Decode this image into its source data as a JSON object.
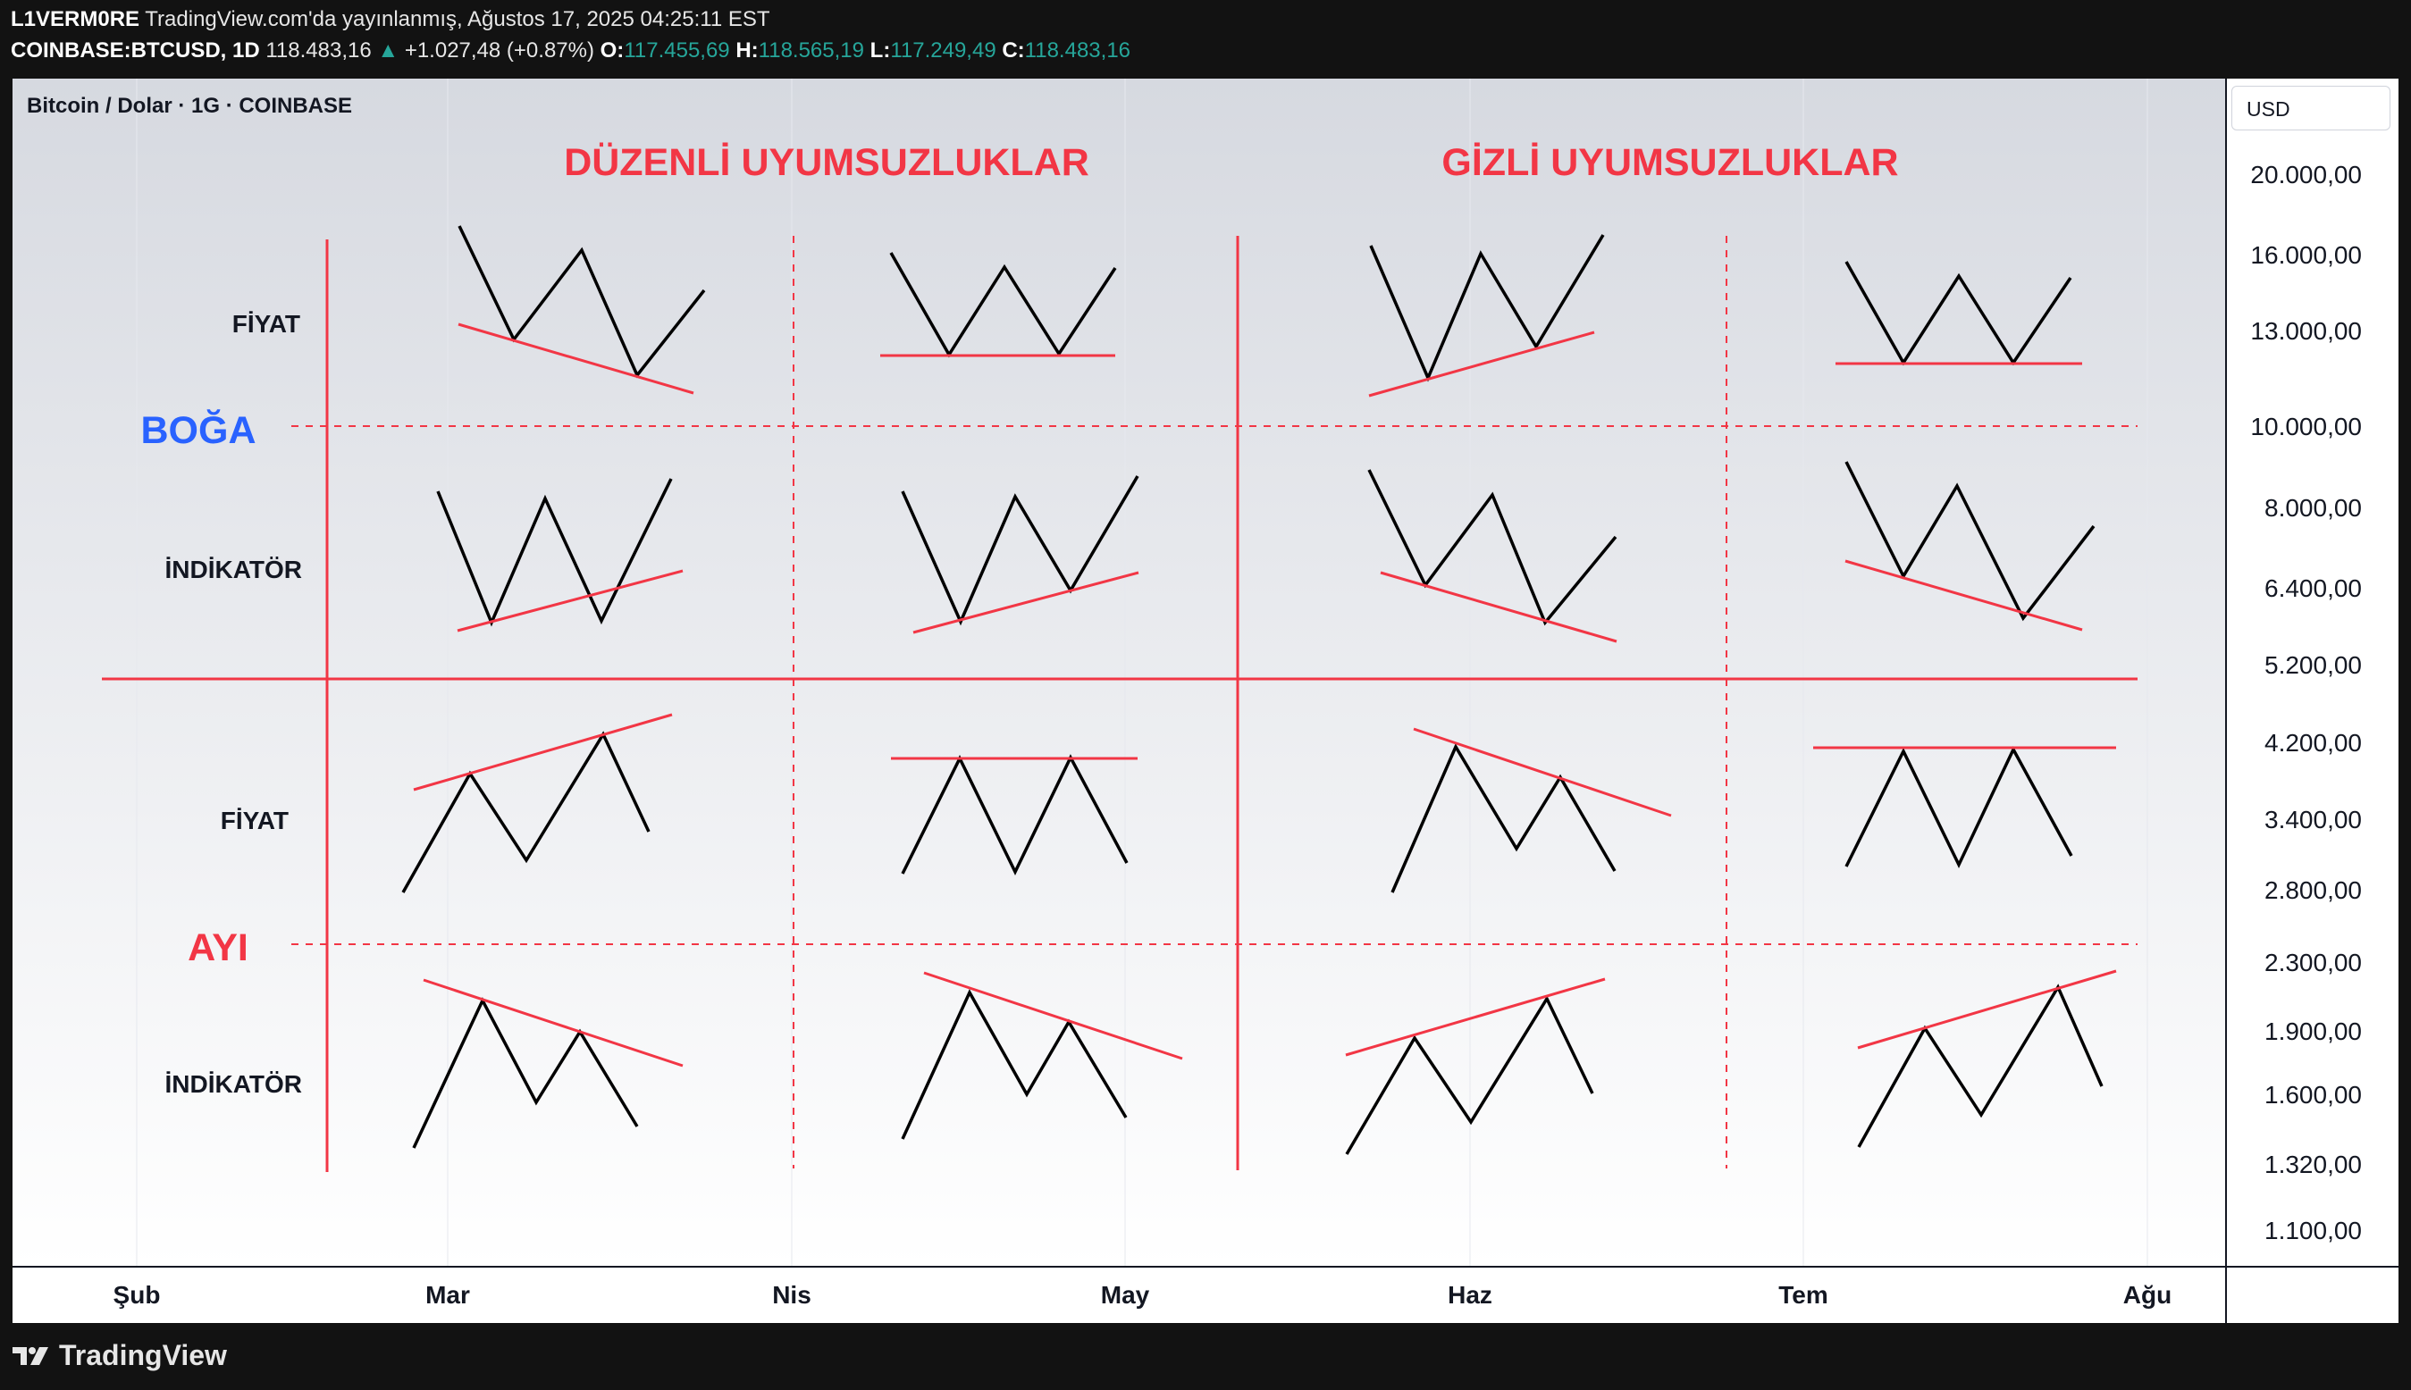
{
  "header": {
    "author": "L1VERM0RE",
    "published": "TradingView.com'da yayınlanmış, Ağustos 17, 2025 04:25:11 EST",
    "symbol": "COINBASE:BTCUSD, 1D",
    "price": "118.483,16",
    "change": "+1.027,48 (+0.87%)",
    "open_label": "O:",
    "open": "117.455,69",
    "high_label": "H:",
    "high": "118.565,19",
    "low_label": "L:",
    "low": "117.249,49",
    "close_label": "C:",
    "close": "118.483,16"
  },
  "chart": {
    "title": "Bitcoin / Dolar · 1G · COINBASE",
    "currency": "USD",
    "y_ticks": [
      "20.000,00",
      "16.000,00",
      "13.000,00",
      "10.000,00",
      "8.000,00",
      "6.400,00",
      "5.200,00",
      "4.200,00",
      "3.400,00",
      "2.800,00",
      "2.300,00",
      "1.900,00",
      "1.600,00",
      "1.320,00",
      "1.100,00"
    ],
    "x_ticks": [
      "Şub",
      "Mar",
      "Nis",
      "May",
      "Haz",
      "Tem",
      "Ağu"
    ]
  },
  "annotations": {
    "regular_title": "DÜZENLİ UYUMSUZLUKLAR",
    "hidden_title": "GİZLİ UYUMSUZLUKLAR",
    "bull": "BOĞA",
    "bear": "AYI",
    "price_label": "FİYAT",
    "indicator_label": "İNDİKATÖR"
  },
  "colors": {
    "red": "#f23645",
    "blue": "#2962ff",
    "up": "#26a69a",
    "line": "#000000"
  },
  "footer": {
    "brand": "TradingView"
  }
}
